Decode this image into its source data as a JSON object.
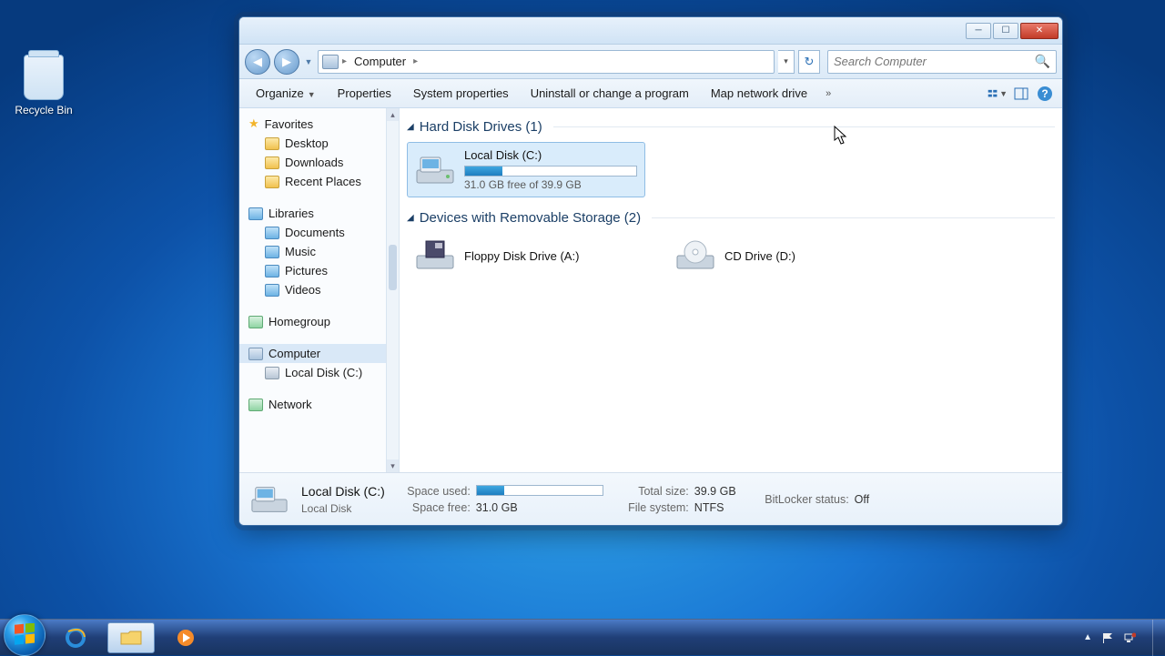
{
  "desktop": {
    "recycle_bin": "Recycle Bin"
  },
  "window": {
    "address_location": "Computer",
    "search_placeholder": "Search Computer",
    "toolbar": {
      "organize": "Organize",
      "properties": "Properties",
      "system_properties": "System properties",
      "uninstall": "Uninstall or change a program",
      "map_drive": "Map network drive"
    },
    "navpane": {
      "favorites": {
        "label": "Favorites",
        "items": [
          "Desktop",
          "Downloads",
          "Recent Places"
        ]
      },
      "libraries": {
        "label": "Libraries",
        "items": [
          "Documents",
          "Music",
          "Pictures",
          "Videos"
        ]
      },
      "homegroup": {
        "label": "Homegroup"
      },
      "computer": {
        "label": "Computer",
        "items": [
          "Local Disk (C:)"
        ]
      },
      "network": {
        "label": "Network"
      }
    },
    "content": {
      "hdd_header": "Hard Disk Drives (1)",
      "removable_header": "Devices with Removable Storage (2)",
      "local_disk": {
        "name": "Local Disk (C:)",
        "free_text": "31.0 GB free of 39.9 GB",
        "fill_pct": 22
      },
      "floppy": {
        "name": "Floppy Disk Drive (A:)"
      },
      "cd": {
        "name": "CD Drive (D:)"
      }
    },
    "details": {
      "name": "Local Disk (C:)",
      "type": "Local Disk",
      "space_used_label": "Space used:",
      "space_free_label": "Space free:",
      "space_free": "31.0 GB",
      "total_size_label": "Total size:",
      "total_size": "39.9 GB",
      "filesystem_label": "File system:",
      "filesystem": "NTFS",
      "bitlocker_label": "BitLocker status:",
      "bitlocker": "Off",
      "fill_pct": 22
    }
  },
  "taskbar": {
    "time": ""
  }
}
